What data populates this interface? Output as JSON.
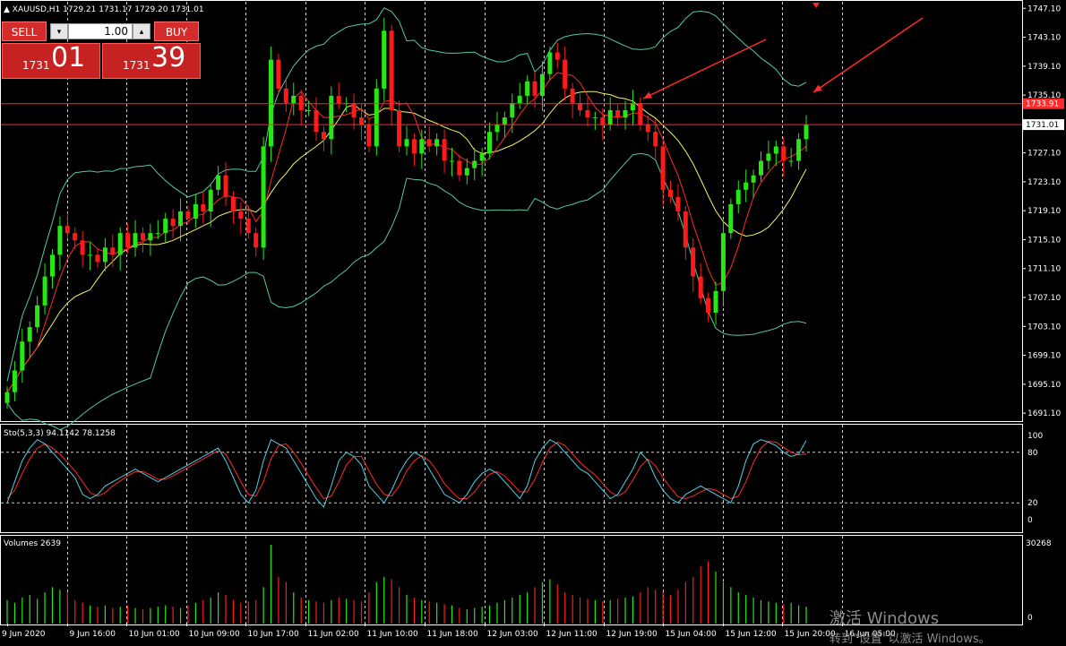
{
  "header": {
    "symbol_line": "▲ XAUUSD,H1  1729.21 1731.17 1729.20 1731.01"
  },
  "trade_panel": {
    "sell_label": "SELL",
    "buy_label": "BUY",
    "lot_value": "1.00",
    "lot_down": "▾",
    "lot_up": "▴",
    "sell_price_small": "1731",
    "sell_price_big": "01",
    "buy_price_small": "1731",
    "buy_price_big": "39"
  },
  "watermark": {
    "line1": "激活 Windows",
    "line2": "转到“设置”以激活 Windows。"
  },
  "colors": {
    "bull": "#26e614",
    "bear": "#ff1a1a",
    "ma_fast": "#ff2a2a",
    "ma_slow": "#f5f36a",
    "bands": "#53c9a3",
    "stoch_main": "#4fd1e8",
    "stoch_signal": "#ff2a2a",
    "grid": "#ffffff",
    "hline": "#ff2a2a",
    "arrow": "#ff2a2a",
    "price_tag": "#ff2a2a"
  },
  "chart_data": [
    {
      "type": "candlestick",
      "title": "XAUUSD,H1",
      "ylim": [
        1690,
        1748
      ],
      "y_ticks": [
        "1747.10",
        "1743.10",
        "1739.10",
        "1735.10",
        "1731.01",
        "1727.10",
        "1723.10",
        "1719.10",
        "1715.10",
        "1711.10",
        "1707.10",
        "1703.10",
        "1699.10",
        "1695.10",
        "1691.10"
      ],
      "y_tick_values": [
        1747.1,
        1743.1,
        1739.1,
        1735.1,
        1731.01,
        1727.1,
        1723.1,
        1719.1,
        1715.1,
        1711.1,
        1707.1,
        1703.1,
        1699.1,
        1695.1,
        1691.1
      ],
      "x_ticks": [
        "9 Jun 2020",
        "9 Jun 16:00",
        "10 Jun 01:00",
        "10 Jun 09:00",
        "10 Jun 17:00",
        "11 Jun 02:00",
        "11 Jun 10:00",
        "11 Jun 18:00",
        "12 Jun 03:00",
        "12 Jun 11:00",
        "12 Jun 19:00",
        "15 Jun 04:00",
        "15 Jun 12:00",
        "15 Jun 20:00",
        "16 Jun 05:00"
      ],
      "current_price_label": "1731.01",
      "current_price": 1731.01,
      "level_label": "1733.91",
      "level_price": 1733.91,
      "close": [
        1694,
        1697,
        1701,
        1703,
        1706,
        1710,
        1713,
        1717,
        1716,
        1715,
        1713,
        1713,
        1712,
        1714,
        1713,
        1716,
        1714,
        1716,
        1715,
        1716,
        1716,
        1718,
        1717,
        1719,
        1718,
        1720,
        1719,
        1722,
        1724,
        1721,
        1719,
        1718,
        1716,
        1714,
        1728,
        1740,
        1736,
        1734,
        1735,
        1733,
        1733,
        1730,
        1729,
        1735,
        1734,
        1734,
        1732,
        1731,
        1728,
        1736,
        1744,
        1733,
        1728,
        1729,
        1727,
        1729,
        1728,
        1729,
        1726,
        1726,
        1724,
        1725,
        1726,
        1727,
        1730,
        1731,
        1732,
        1734,
        1735,
        1737,
        1735,
        1738,
        1741,
        1740,
        1736,
        1734,
        1733,
        1732,
        1732,
        1731,
        1733,
        1732,
        1733,
        1734,
        1731,
        1730,
        1728,
        1722,
        1721,
        1719,
        1714,
        1710,
        1707,
        1705,
        1708,
        1716,
        1720,
        1722,
        1723,
        1724,
        1726,
        1727,
        1728,
        1726,
        1726,
        1729,
        1731
      ],
      "volume_max_label": "30268",
      "volume_max": 30268,
      "volumes": [
        9000,
        8000,
        10000,
        11000,
        9500,
        12000,
        14000,
        13000,
        12000,
        9000,
        8000,
        7000,
        6500,
        7000,
        6000,
        6500,
        7000,
        6000,
        5500,
        6000,
        6500,
        7000,
        6500,
        6000,
        7000,
        8000,
        9000,
        10000,
        12000,
        11000,
        9000,
        8000,
        8500,
        9000,
        14000,
        30268,
        18000,
        16000,
        12000,
        10000,
        9000,
        8500,
        8000,
        9000,
        10000,
        9500,
        9000,
        8500,
        12000,
        16000,
        18000,
        17000,
        14000,
        11000,
        10000,
        9000,
        8500,
        8000,
        7500,
        7000,
        6000,
        5500,
        6000,
        6500,
        7000,
        8000,
        9000,
        10000,
        11000,
        12000,
        14000,
        16000,
        17000,
        15000,
        12000,
        11000,
        10000,
        9500,
        9000,
        8500,
        9000,
        9500,
        10000,
        10500,
        12000,
        14000,
        13000,
        12000,
        11000,
        13000,
        16000,
        18000,
        22000,
        24000,
        20000,
        16000,
        14000,
        12000,
        11000,
        10000,
        9000,
        8500,
        8000,
        7500,
        8000,
        7000,
        6500
      ]
    },
    {
      "type": "line",
      "title": "Sto(5,3,3) 94.1142 78.1258",
      "ylim": [
        0,
        100
      ],
      "y_ticks": [
        "100",
        "80",
        "20",
        "0"
      ],
      "y_tick_values": [
        100,
        80,
        20,
        0
      ],
      "series": [
        {
          "values": [
            20,
            45,
            70,
            85,
            95,
            90,
            80,
            70,
            60,
            50,
            30,
            25,
            30,
            40,
            45,
            50,
            55,
            60,
            55,
            50,
            45,
            50,
            55,
            60,
            65,
            70,
            75,
            80,
            85,
            70,
            50,
            30,
            20,
            35,
            70,
            95,
            90,
            85,
            70,
            55,
            40,
            25,
            15,
            40,
            70,
            80,
            75,
            65,
            40,
            30,
            20,
            35,
            55,
            70,
            80,
            75,
            60,
            45,
            30,
            25,
            20,
            30,
            45,
            55,
            60,
            55,
            45,
            35,
            25,
            40,
            70,
            85,
            95,
            90,
            80,
            70,
            60,
            55,
            45,
            35,
            25,
            30,
            45,
            60,
            80,
            70,
            50,
            35,
            25,
            20,
            30,
            35,
            40,
            35,
            30,
            25,
            20,
            40,
            70,
            90,
            95,
            92,
            88,
            80,
            75,
            78,
            94
          ]
        },
        {
          "values": [
            25,
            35,
            55,
            72,
            85,
            90,
            85,
            78,
            68,
            58,
            45,
            32,
            28,
            32,
            40,
            46,
            52,
            57,
            57,
            53,
            48,
            48,
            52,
            57,
            62,
            67,
            72,
            77,
            82,
            78,
            62,
            45,
            30,
            28,
            45,
            72,
            88,
            90,
            80,
            67,
            52,
            38,
            25,
            28,
            45,
            65,
            75,
            75,
            58,
            42,
            30,
            28,
            40,
            58,
            70,
            76,
            70,
            58,
            43,
            33,
            25,
            25,
            33,
            45,
            54,
            57,
            52,
            43,
            33,
            33,
            48,
            68,
            85,
            92,
            88,
            78,
            68,
            60,
            53,
            43,
            33,
            28,
            33,
            47,
            63,
            72,
            64,
            50,
            38,
            27,
            25,
            28,
            33,
            37,
            35,
            30,
            25,
            28,
            45,
            68,
            85,
            93,
            92,
            86,
            80,
            77,
            78
          ]
        }
      ]
    }
  ]
}
